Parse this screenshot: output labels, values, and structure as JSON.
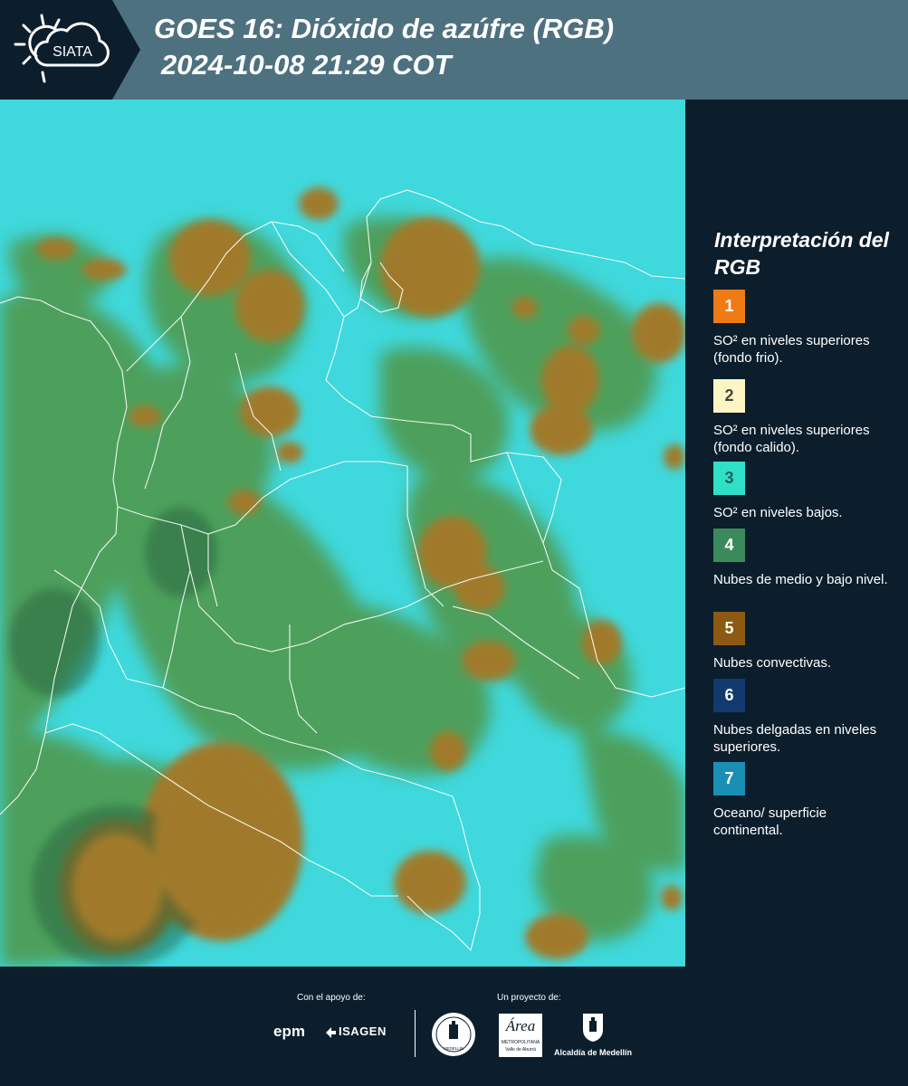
{
  "header": {
    "logo_text": "SIATA",
    "title_line1": "GOES 16: Dióxido de azúfre (RGB)",
    "title_line2": "2024-10-08 21:29 COT"
  },
  "colors": {
    "header_bg": "#4e7180",
    "dark_bg": "#0c1e2c",
    "map_background": "#3fd8dc",
    "low_clouds": "#4f9a50",
    "convective": "#a07a2c"
  },
  "legend": {
    "title": "Interpretación del RGB",
    "items": [
      {
        "number": "1",
        "color": "#f07b14",
        "text": "SO² en niveles superiores (fondo frio)."
      },
      {
        "number": "2",
        "color": "#fdf5c4",
        "text": "SO² en niveles superiores (fondo calido)."
      },
      {
        "number": "3",
        "color": "#2fe0c6",
        "text": "SO² en niveles bajos."
      },
      {
        "number": "4",
        "color": "#3a8a5c",
        "text": "Nubes de medio y bajo nivel."
      },
      {
        "number": "5",
        "color": "#8c5a12",
        "text": "Nubes convectivas."
      },
      {
        "number": "6",
        "color": "#123a6e",
        "text": "Nubes delgadas en niveles superiores."
      },
      {
        "number": "7",
        "color": "#1a8fb4",
        "text": "Oceano/ superficie continental."
      }
    ]
  },
  "footer": {
    "support_label": "Con el apoyo de:",
    "project_label": "Un proyecto de:",
    "epm": "epm",
    "isagen": "ISAGEN",
    "area_script": "Área",
    "area_line1": "METROPOLITANA",
    "area_line2": "Valle de Aburrá",
    "medellin": "Alcaldía de Medellín",
    "seal_text": "MEDELLÍN"
  }
}
